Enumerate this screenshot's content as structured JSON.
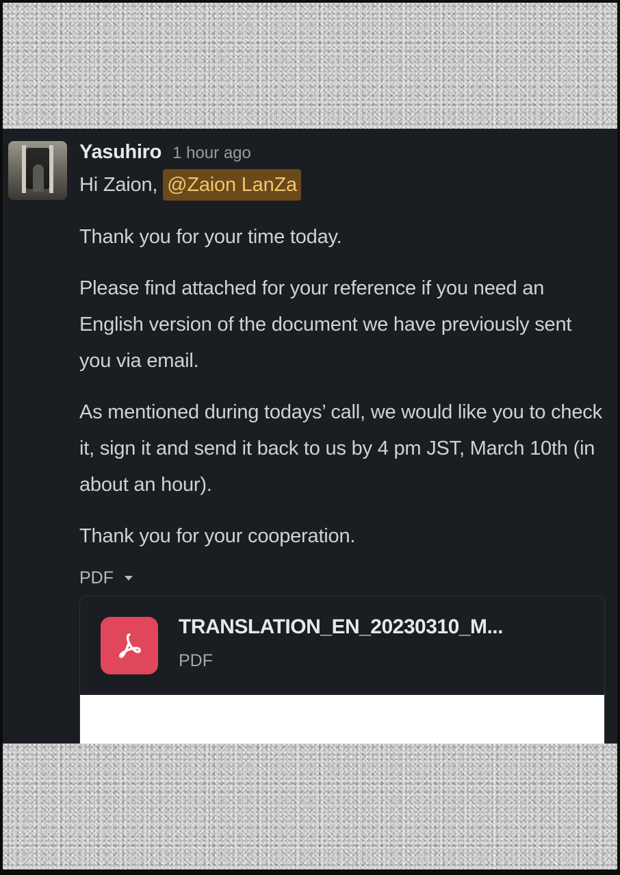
{
  "message": {
    "sender": "Yasuhiro",
    "timestamp": "1 hour ago",
    "greeting_prefix": "Hi Zaion,",
    "mention": "@Zaion LanZa",
    "paragraphs": [
      "Thank you for your time today.",
      "Please find attached for your reference if you need an English version of the document we have previously sent you via email.",
      "As mentioned during todays’ call, we would like you to check it, sign it and send it back to us by 4 pm JST, March 10th (in about an hour).",
      "Thank you for your cooperation."
    ]
  },
  "file_toggle": {
    "label": "PDF",
    "icon": "caret-down-icon"
  },
  "attachment": {
    "file_name": "TRANSLATION_EN_20230310_M...",
    "file_type": "PDF",
    "icon": "pdf-icon"
  },
  "colors": {
    "panel_background": "#1a1d21",
    "mention_background": "#6a4a1a",
    "mention_text": "#f2c46b",
    "pdf_icon_background": "#e0475b"
  }
}
